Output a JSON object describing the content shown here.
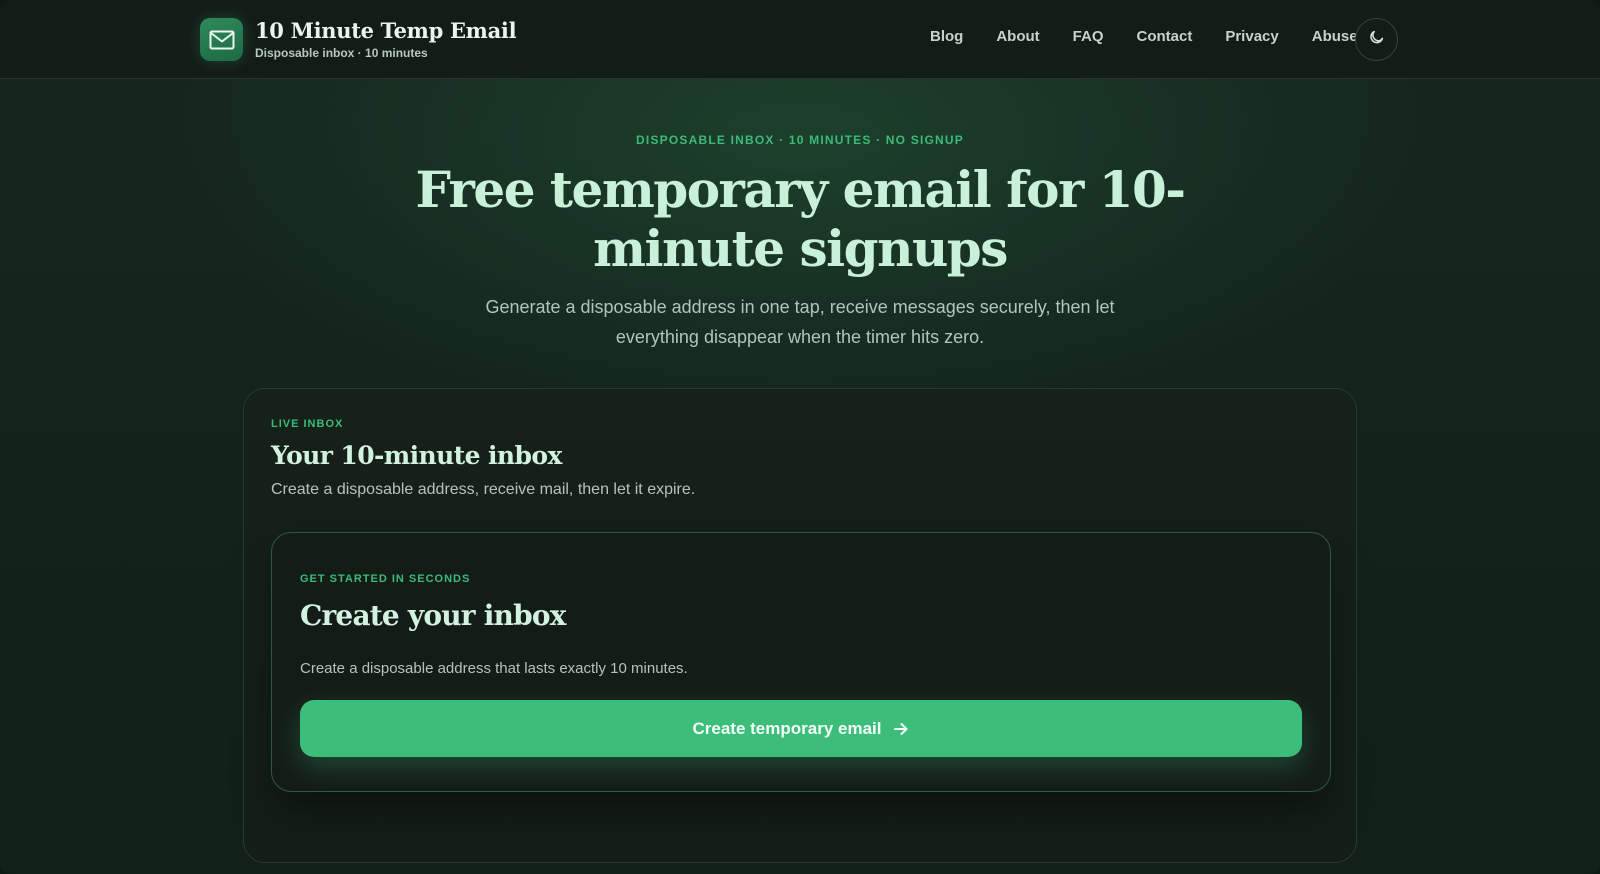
{
  "brand": {
    "title": "10 Minute Temp Email",
    "subtitle": "Disposable inbox · 10 minutes",
    "logo_icon": "mail-icon"
  },
  "nav": {
    "links": [
      "Blog",
      "About",
      "FAQ",
      "Contact",
      "Privacy",
      "Abuse"
    ],
    "theme_toggle_icon": "moon-icon"
  },
  "hero": {
    "eyebrow": "DISPOSABLE INBOX · 10 MINUTES · NO SIGNUP",
    "headline": "Free temporary email for 10-minute signups",
    "subline": "Generate a disposable address in one tap, receive messages securely, then let everything disappear when the timer hits zero."
  },
  "inbox_card": {
    "eyebrow": "LIVE INBOX",
    "title": "Your 10-minute inbox",
    "description": "Create a disposable address, receive mail, then let it expire.",
    "start_panel": {
      "eyebrow": "GET STARTED IN SECONDS",
      "title": "Create your inbox",
      "description": "Create a disposable address that lasts exactly 10 minutes.",
      "cta_label": "Create temporary email",
      "cta_icon": "arrow-right-icon"
    }
  },
  "colors": {
    "accent": "#3dbd7a",
    "eyebrow": "#3cbb78",
    "headline": "#c9f0d8",
    "background": "#13231b"
  }
}
